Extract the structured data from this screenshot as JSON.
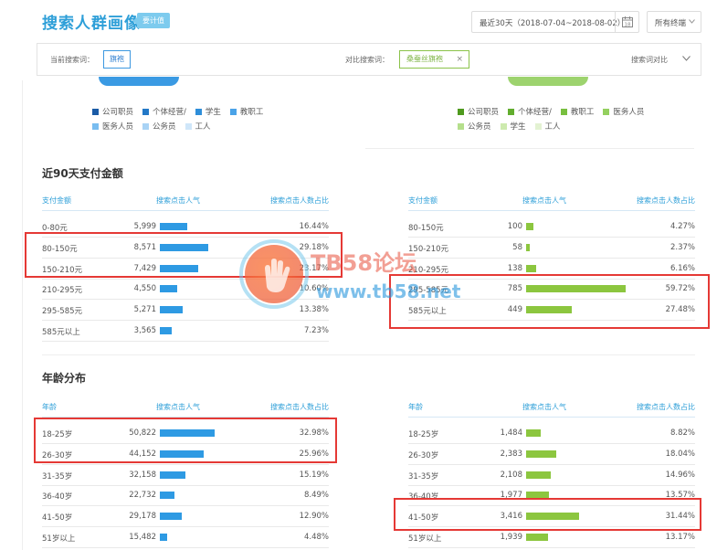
{
  "header": {
    "title": "搜索人群画像",
    "badge": "要计值",
    "date_range": "最近30天（2018-07-04~2018-08-02）",
    "calendar_day": "18",
    "terminal": "所有终端"
  },
  "compare": {
    "current_label": "当前搜索词：",
    "current_term": "旗袍",
    "compare_label": "对比搜索词：",
    "compare_term": "桑蚕丝旗袍",
    "close_glyph": "×",
    "toggle_label": "搜索词对比"
  },
  "legend_left": {
    "row1": [
      {
        "label": "公司职员",
        "color": "#1a5ba6"
      },
      {
        "label": "个体经营/",
        "color": "#2378c7"
      },
      {
        "label": "学生",
        "color": "#2e8ed9"
      },
      {
        "label": "教职工",
        "color": "#4aa3e8"
      }
    ],
    "row2": [
      {
        "label": "医务人员",
        "color": "#79bdf0"
      },
      {
        "label": "公务员",
        "color": "#a9d3f5"
      },
      {
        "label": "工人",
        "color": "#cfe6f9"
      }
    ]
  },
  "legend_right": {
    "row1": [
      {
        "label": "公司职员",
        "color": "#4f9a1e"
      },
      {
        "label": "个体经营/",
        "color": "#62ad2e"
      },
      {
        "label": "教职工",
        "color": "#78bf3f"
      },
      {
        "label": "医务人员",
        "color": "#94d05f"
      }
    ],
    "row2": [
      {
        "label": "公务员",
        "color": "#b5df8c"
      },
      {
        "label": "学生",
        "color": "#cdeaae"
      },
      {
        "label": "工人",
        "color": "#e3f2d2"
      }
    ]
  },
  "pay": {
    "title": "近90天支付金额",
    "headers": {
      "c1": "支付金额",
      "c2": "搜索点击人气",
      "c3": "搜索点击人数占比"
    },
    "left": [
      {
        "label": "0-80元",
        "value": "5,999",
        "pct": "16.44%",
        "share": 16.44
      },
      {
        "label": "80-150元",
        "value": "8,571",
        "pct": "29.18%",
        "share": 29.18
      },
      {
        "label": "150-210元",
        "value": "7,429",
        "pct": "23.17%",
        "share": 23.17
      },
      {
        "label": "210-295元",
        "value": "4,550",
        "pct": "10.60%",
        "share": 10.6
      },
      {
        "label": "295-585元",
        "value": "5,271",
        "pct": "13.38%",
        "share": 13.38
      },
      {
        "label": "585元以上",
        "value": "3,565",
        "pct": "7.23%",
        "share": 7.23
      }
    ],
    "right": [
      {
        "label": "80-150元",
        "value": "100",
        "pct": "4.27%",
        "share": 4.27
      },
      {
        "label": "150-210元",
        "value": "58",
        "pct": "2.37%",
        "share": 2.37
      },
      {
        "label": "210-295元",
        "value": "138",
        "pct": "6.16%",
        "share": 6.16
      },
      {
        "label": "295-585元",
        "value": "785",
        "pct": "59.72%",
        "share": 59.72
      },
      {
        "label": "585元以上",
        "value": "449",
        "pct": "27.48%",
        "share": 27.48
      }
    ]
  },
  "age": {
    "title": "年龄分布",
    "headers": {
      "c1": "年龄",
      "c2": "搜索点击人气",
      "c3": "搜索点击人数占比"
    },
    "left": [
      {
        "label": "18-25岁",
        "value": "50,822",
        "pct": "32.98%",
        "share": 32.98
      },
      {
        "label": "26-30岁",
        "value": "44,152",
        "pct": "25.96%",
        "share": 25.96
      },
      {
        "label": "31-35岁",
        "value": "32,158",
        "pct": "15.19%",
        "share": 15.19
      },
      {
        "label": "36-40岁",
        "value": "22,732",
        "pct": "8.49%",
        "share": 8.49
      },
      {
        "label": "41-50岁",
        "value": "29,178",
        "pct": "12.90%",
        "share": 12.9
      },
      {
        "label": "51岁以上",
        "value": "15,482",
        "pct": "4.48%",
        "share": 4.48
      }
    ],
    "right": [
      {
        "label": "18-25岁",
        "value": "1,484",
        "pct": "8.82%",
        "share": 8.82
      },
      {
        "label": "26-30岁",
        "value": "2,383",
        "pct": "18.04%",
        "share": 18.04
      },
      {
        "label": "31-35岁",
        "value": "2,108",
        "pct": "14.96%",
        "share": 14.96
      },
      {
        "label": "36-40岁",
        "value": "1,977",
        "pct": "13.57%",
        "share": 13.57
      },
      {
        "label": "41-50岁",
        "value": "3,416",
        "pct": "31.44%",
        "share": 31.44
      },
      {
        "label": "51岁以上",
        "value": "1,939",
        "pct": "13.17%",
        "share": 13.17
      }
    ]
  },
  "colors": {
    "blue_bar": "#2e9ae3",
    "green_bar": "#8cc63f",
    "header_blue": "#2e9fd8",
    "highlight": "#e53935"
  },
  "watermark": {
    "line1": "TB58论坛",
    "line2": "www.tb58.net"
  }
}
